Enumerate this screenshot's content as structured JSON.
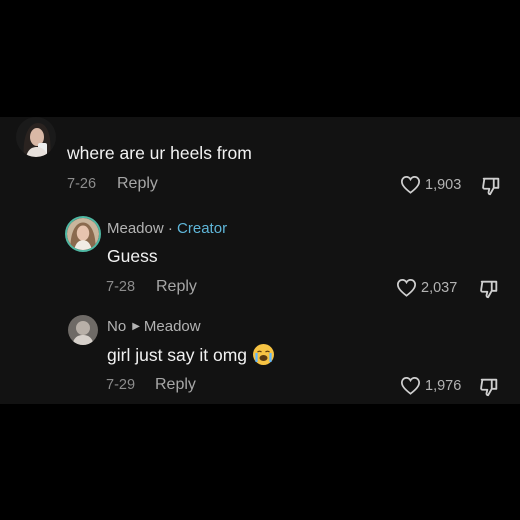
{
  "comments": [
    {
      "text": "where are ur heels from",
      "date": "7-26",
      "reply_label": "Reply",
      "likes": "1,903"
    },
    {
      "username": "Meadow",
      "separator": " · ",
      "badge": "Creator",
      "text": "Guess",
      "date": "7-28",
      "reply_label": "Reply",
      "likes": "2,037"
    },
    {
      "username": "No",
      "reply_to": "Meadow",
      "text": "girl just say it omg",
      "emoji": "loudly-crying-face",
      "date": "7-29",
      "reply_label": "Reply",
      "likes": "1,976"
    }
  ],
  "colors": {
    "background": "#000000",
    "panel": "#121212",
    "creator_badge": "#5fb6d9",
    "text": "#f2f2f2",
    "muted": "#8c8c8c"
  }
}
